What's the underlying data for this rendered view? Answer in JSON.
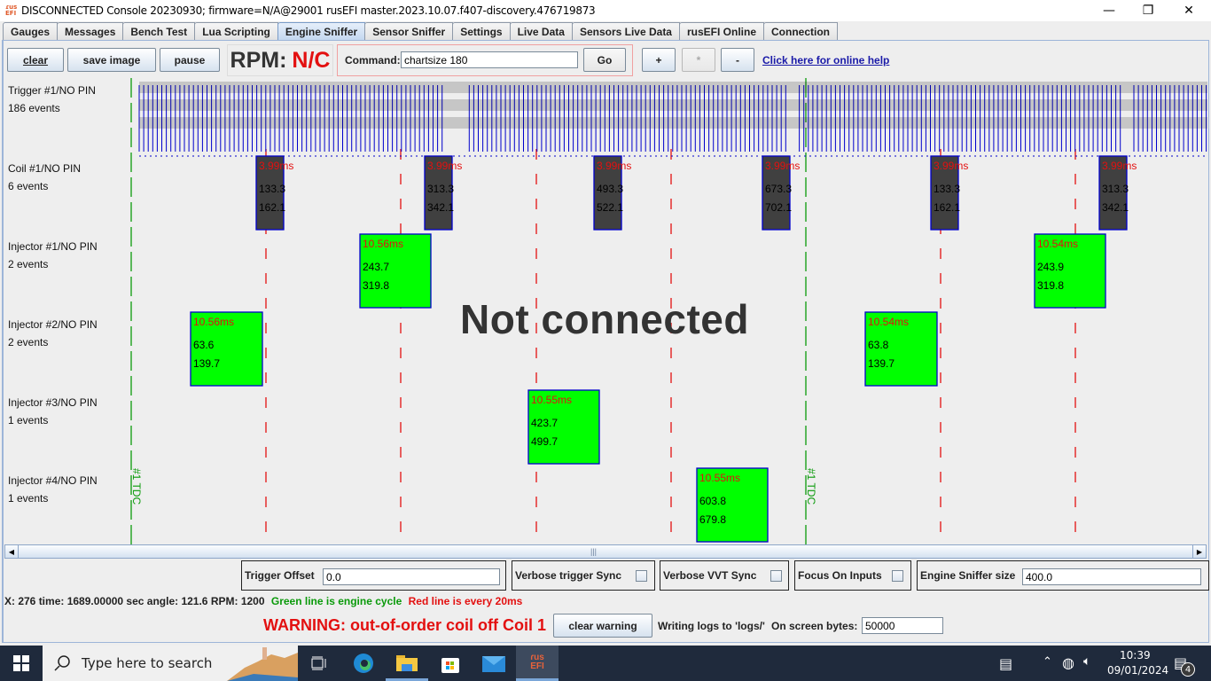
{
  "window": {
    "title": "DISCONNECTED Console 20230930; firmware=N/A@29001 rusEFI master.2023.10.07.f407-discovery.476719873",
    "app_icon": "rusefi-icon",
    "controls": {
      "minimize": "—",
      "restore": "❐",
      "close": "✕"
    }
  },
  "tabs": [
    {
      "label": "Gauges",
      "active": false
    },
    {
      "label": "Messages",
      "active": false
    },
    {
      "label": "Bench Test",
      "active": false
    },
    {
      "label": "Lua Scripting",
      "active": false
    },
    {
      "label": "Engine Sniffer",
      "active": true
    },
    {
      "label": "Sensor Sniffer",
      "active": false
    },
    {
      "label": "Settings",
      "active": false
    },
    {
      "label": "Live Data",
      "active": false
    },
    {
      "label": "Sensors Live Data",
      "active": false
    },
    {
      "label": "rusEFI Online",
      "active": false
    },
    {
      "label": "Connection",
      "active": false
    }
  ],
  "toolbar": {
    "clear_label": "clear",
    "save_image_label": "save image",
    "pause_label": "pause",
    "rpm_label": "RPM:",
    "rpm_value": "N/C",
    "command_label": "Command:",
    "command_value": "chartsize 180",
    "go_label": "Go",
    "zoom_in_label": "+",
    "zoom_reset_label": "*",
    "zoom_out_label": "-",
    "help_link": "Click here for online help"
  },
  "sniffer": {
    "overlay_text": "Not connected",
    "tdc_label": "#1 TDC",
    "rows": [
      {
        "name": "Trigger #1/NO PIN",
        "events": "186 events"
      },
      {
        "name": "Coil #1/NO PIN",
        "events": "6 events"
      },
      {
        "name": "Injector #1/NO PIN",
        "events": "2 events"
      },
      {
        "name": "Injector #2/NO PIN",
        "events": "2 events"
      },
      {
        "name": "Injector #3/NO PIN",
        "events": "1 events"
      },
      {
        "name": "Injector #4/NO PIN",
        "events": "1 events"
      }
    ],
    "coil_events": [
      {
        "duration": "3.99ms",
        "start": "133.3",
        "end": "162.1"
      },
      {
        "duration": "3.99ms",
        "start": "313.3",
        "end": "342.1"
      },
      {
        "duration": "3.99ms",
        "start": "493.3",
        "end": "522.1"
      },
      {
        "duration": "3.99ms",
        "start": "673.3",
        "end": "702.1"
      },
      {
        "duration": "3.99ms",
        "start": "133.3",
        "end": "162.1"
      },
      {
        "duration": "3.99ms",
        "start": "313.3",
        "end": "342.1"
      }
    ],
    "injector1_events": [
      {
        "duration": "10.56ms",
        "start": "243.7",
        "end": "319.8"
      },
      {
        "duration": "10.54ms",
        "start": "243.9",
        "end": "319.8"
      }
    ],
    "injector2_events": [
      {
        "duration": "10.56ms",
        "start": "63.6",
        "end": "139.7"
      },
      {
        "duration": "10.54ms",
        "start": "63.8",
        "end": "139.7"
      }
    ],
    "injector3_events": [
      {
        "duration": "10.55ms",
        "start": "423.7",
        "end": "499.7"
      }
    ],
    "injector4_events": [
      {
        "duration": "10.55ms",
        "start": "603.8",
        "end": "679.8"
      }
    ],
    "colors": {
      "engine_cycle_line": "#0a9a0a",
      "time_line": "#e31010",
      "trigger_line": "#0000cc",
      "coil_fill": "#404040",
      "injector_fill": "#00ff00",
      "event_border": "#0000cc"
    }
  },
  "options": {
    "trigger_offset_label": "Trigger Offset",
    "trigger_offset_value": "0.0",
    "verbose_trigger_label": "Verbose trigger Sync",
    "verbose_trigger_checked": false,
    "verbose_vvt_label": "Verbose VVT Sync",
    "verbose_vvt_checked": false,
    "focus_inputs_label": "Focus On Inputs",
    "focus_inputs_checked": false,
    "sniffer_size_label": "Engine Sniffer size",
    "sniffer_size_value": "400.0"
  },
  "status": {
    "cursor_info": "X: 276 time: 1689.00000 sec angle: 121.6 RPM: 1200",
    "green_legend": "Green line is engine cycle",
    "red_legend": "Red line is every 20ms",
    "warning": "WARNING: out-of-order coil off Coil 1",
    "clear_warning_label": "clear warning",
    "log_text": "Writing logs to 'logs/'",
    "bytes_label": "On screen bytes:",
    "bytes_value": "50000"
  },
  "taskbar": {
    "search_placeholder": "Type here to search",
    "apps": [
      "task-view",
      "edge",
      "file-explorer",
      "microsoft-store",
      "mail",
      "rusefi"
    ],
    "time": "10:39",
    "date": "09/01/2024",
    "notification_count": "4"
  }
}
